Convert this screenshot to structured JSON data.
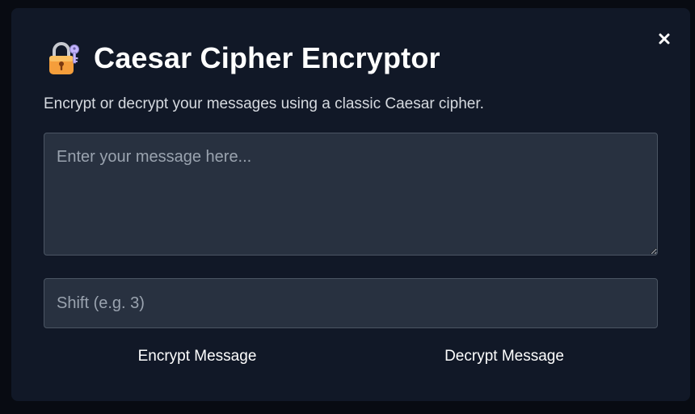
{
  "dialog": {
    "title": "Caesar Cipher Encryptor",
    "title_icon": "lock-with-key-icon",
    "subtitle": "Encrypt or decrypt your messages using a classic Caesar cipher.",
    "close_icon": "close-icon"
  },
  "form": {
    "message": {
      "value": "",
      "placeholder": "Enter your message here..."
    },
    "shift": {
      "value": "",
      "placeholder": "Shift (e.g. 3)"
    }
  },
  "actions": {
    "encrypt_label": "Encrypt Message",
    "decrypt_label": "Decrypt Message"
  },
  "colors": {
    "page_background": "#080b12",
    "dialog_background": "#111827",
    "input_background": "#283140",
    "input_border": "#4b5563",
    "text_primary": "#ffffff",
    "text_secondary": "#d6dae0",
    "placeholder": "#9aa3af"
  }
}
